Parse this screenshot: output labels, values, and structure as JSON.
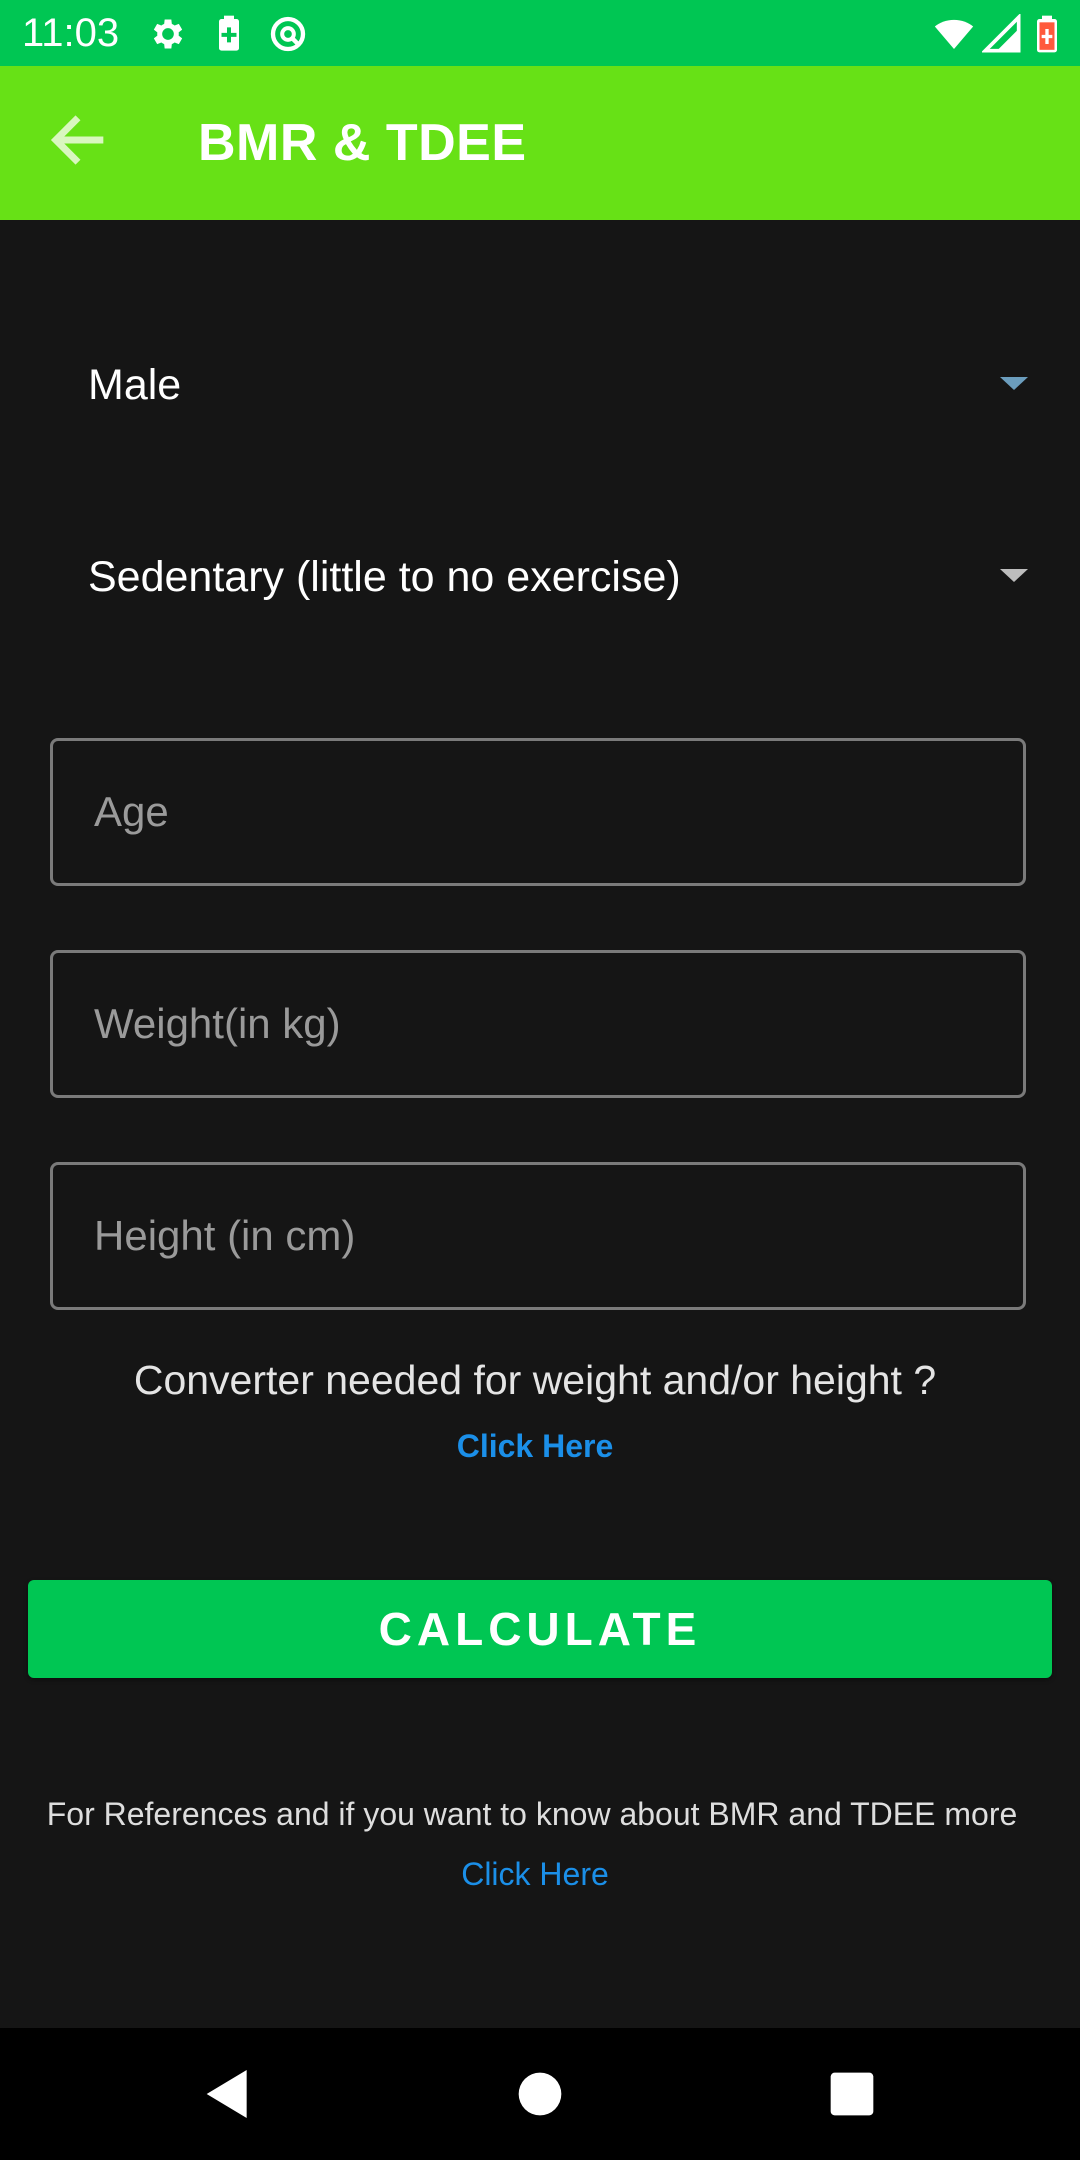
{
  "status_bar": {
    "time": "11:03",
    "background": "#00c653",
    "left_icons": [
      "settings-icon",
      "battery-saver-icon",
      "vpn-icon"
    ],
    "right_icons": [
      "wifi-icon",
      "signal-icon",
      "battery-icon"
    ]
  },
  "app_bar": {
    "title": "BMR & TDEE",
    "back_icon": "arrow-back-icon",
    "background": "#67e116"
  },
  "form": {
    "gender": {
      "selected": "Male"
    },
    "activity": {
      "selected": "Sedentary (little to no exercise)"
    },
    "age": {
      "placeholder": "Age",
      "value": ""
    },
    "weight": {
      "placeholder": "Weight(in kg)",
      "value": ""
    },
    "height": {
      "placeholder": "Height (in cm)",
      "value": ""
    },
    "converter_prompt": "Converter needed for weight and/or height ?",
    "converter_link": "Click Here",
    "calculate_label": "CALCULATE"
  },
  "references": {
    "text": "For References and if you want to know about BMR and TDEE more",
    "link": "Click Here"
  },
  "colors": {
    "accent": "#00c653",
    "toolbar": "#67e116",
    "link": "#1b8fe8",
    "background": "#151515"
  },
  "nav_bar": {
    "icons": [
      "back-triangle-icon",
      "home-circle-icon",
      "recents-square-icon"
    ]
  }
}
